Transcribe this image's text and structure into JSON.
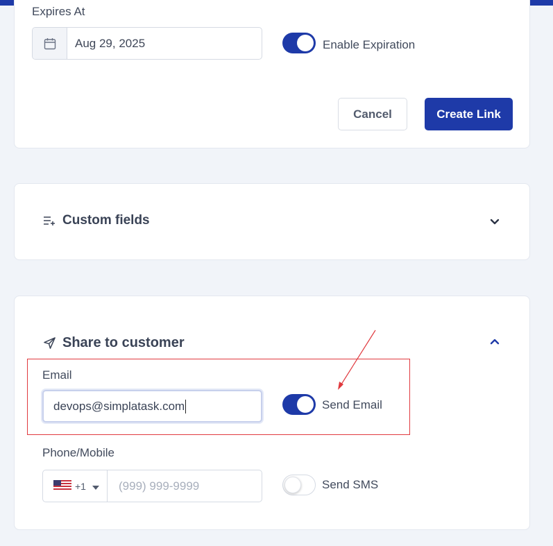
{
  "expiration": {
    "label": "Expires At",
    "date_value": "Aug 29, 2025",
    "toggle_label": "Enable Expiration",
    "enabled": true
  },
  "actions": {
    "cancel_label": "Cancel",
    "create_label": "Create Link"
  },
  "custom_fields": {
    "title": "Custom fields"
  },
  "share": {
    "title": "Share to customer",
    "email_label": "Email",
    "email_value": "devops@simplatask.com",
    "send_email_label": "Send Email",
    "send_email_enabled": true,
    "phone_label": "Phone/Mobile",
    "country_code": "+1",
    "phone_placeholder": "(999) 999-9999",
    "send_sms_label": "Send SMS",
    "send_sms_enabled": false
  },
  "colors": {
    "primary": "#1e3aa8",
    "annotation": "#e0393e",
    "background": "#f1f4f9"
  }
}
